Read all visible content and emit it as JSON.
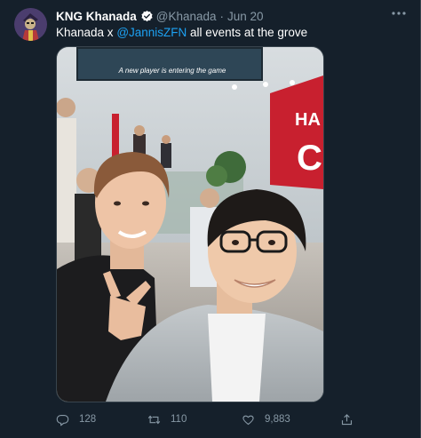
{
  "tweet": {
    "display_name": "KNG Khanada",
    "handle": "@Khanada",
    "separator": "·",
    "date": "Jun 20",
    "text_before": "Khanada x ",
    "mention": "@JannisZFN",
    "text_after": " all events at the grove",
    "media": {
      "screen_caption": "A new player is entering the game",
      "sign_text_1": "HA",
      "sign_text_2": "C"
    },
    "actions": {
      "reply_count": "128",
      "retweet_count": "110",
      "like_count": "9,883"
    }
  },
  "colors": {
    "background": "#15202b",
    "secondary_text": "#8899a6",
    "accent": "#1da1f2",
    "border": "#38444d"
  },
  "icons": {
    "verified": "verified-badge-icon",
    "more": "more-dots-icon",
    "reply": "reply-icon",
    "retweet": "retweet-icon",
    "like": "heart-icon",
    "share": "share-icon"
  }
}
